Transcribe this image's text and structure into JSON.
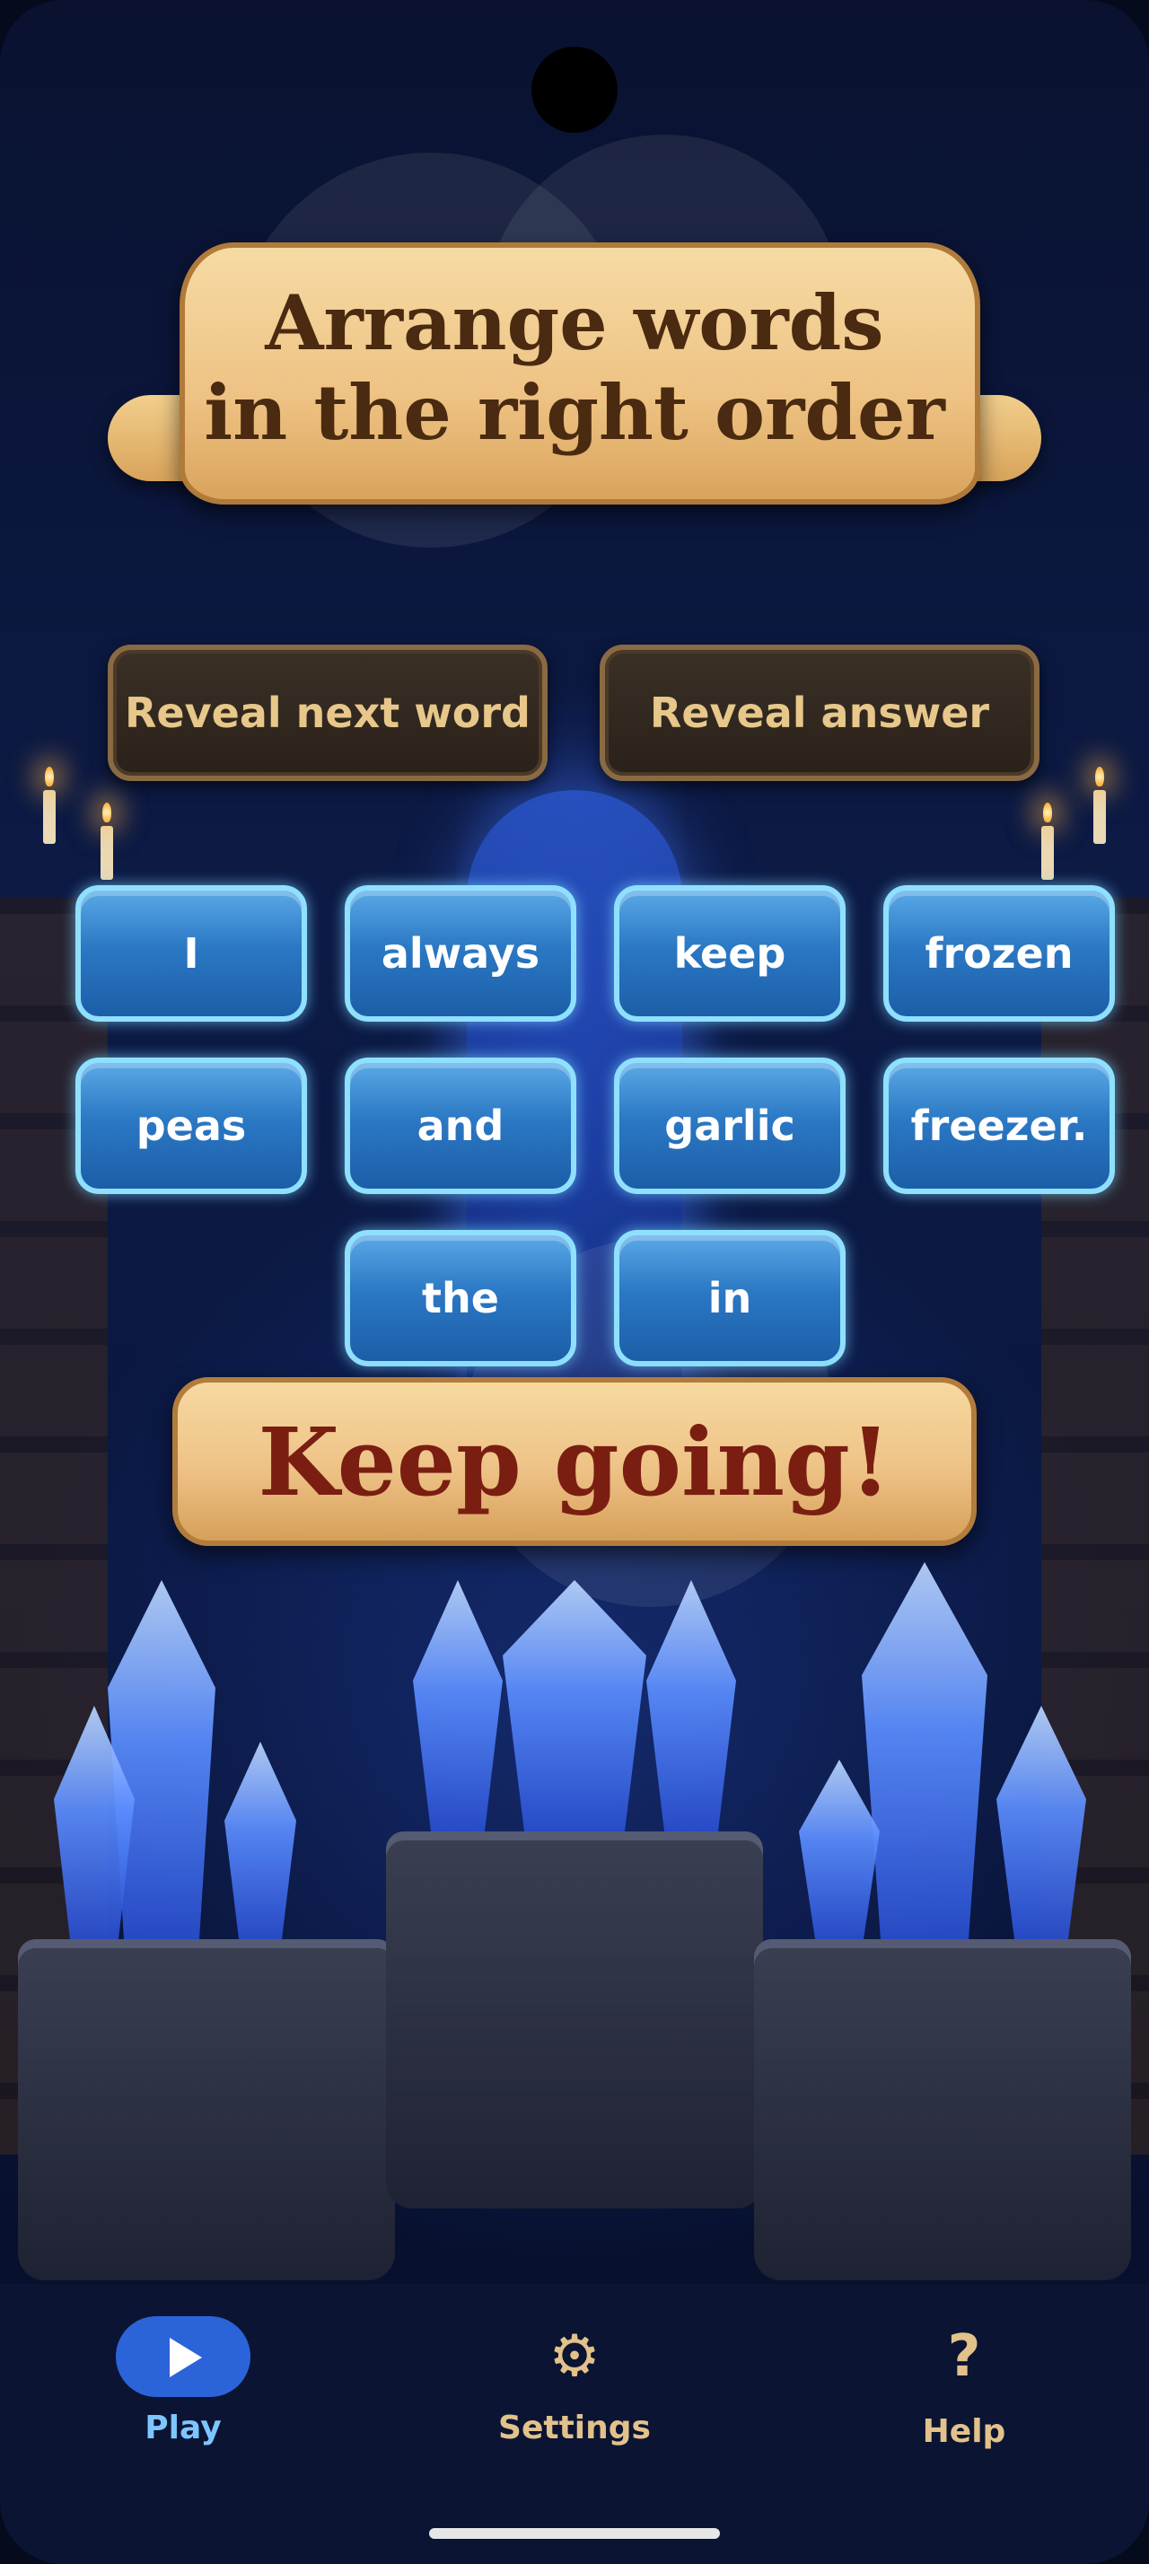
{
  "title": {
    "line1": "Arrange words",
    "line2": "in the right order"
  },
  "hints": {
    "reveal_next": "Reveal next word",
    "reveal_answer": "Reveal answer"
  },
  "words": [
    "I",
    "always",
    "keep",
    "frozen",
    "peas",
    "and",
    "garlic",
    "freezer.",
    "the",
    "in"
  ],
  "feedback": "Keep going!",
  "nav": {
    "play": "Play",
    "settings": "Settings",
    "help": "Help",
    "settings_icon": "⚙",
    "help_icon": "?"
  },
  "colors": {
    "accent": "#2b64d8",
    "tile": "#2b78c4",
    "tile_border": "#8fe0ff",
    "feedback_text": "#7a1e12"
  }
}
